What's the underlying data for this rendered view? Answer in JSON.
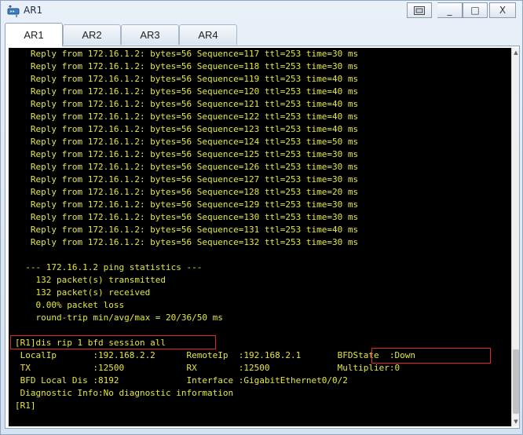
{
  "window": {
    "title": "AR1",
    "tabs": [
      "AR1",
      "AR2",
      "AR3",
      "AR4"
    ],
    "active_tab": "AR1"
  },
  "controls": {
    "restore": "▭",
    "minimize": "_",
    "maximize": "□",
    "close": "X"
  },
  "terminal": {
    "lines": [
      "   Reply from 172.16.1.2: bytes=56 Sequence=117 ttl=253 time=30 ms",
      "   Reply from 172.16.1.2: bytes=56 Sequence=118 ttl=253 time=30 ms",
      "   Reply from 172.16.1.2: bytes=56 Sequence=119 ttl=253 time=40 ms",
      "   Reply from 172.16.1.2: bytes=56 Sequence=120 ttl=253 time=40 ms",
      "   Reply from 172.16.1.2: bytes=56 Sequence=121 ttl=253 time=40 ms",
      "   Reply from 172.16.1.2: bytes=56 Sequence=122 ttl=253 time=40 ms",
      "   Reply from 172.16.1.2: bytes=56 Sequence=123 ttl=253 time=40 ms",
      "   Reply from 172.16.1.2: bytes=56 Sequence=124 ttl=253 time=50 ms",
      "   Reply from 172.16.1.2: bytes=56 Sequence=125 ttl=253 time=30 ms",
      "   Reply from 172.16.1.2: bytes=56 Sequence=126 ttl=253 time=30 ms",
      "   Reply from 172.16.1.2: bytes=56 Sequence=127 ttl=253 time=30 ms",
      "   Reply from 172.16.1.2: bytes=56 Sequence=128 ttl=253 time=20 ms",
      "   Reply from 172.16.1.2: bytes=56 Sequence=129 ttl=253 time=30 ms",
      "   Reply from 172.16.1.2: bytes=56 Sequence=130 ttl=253 time=30 ms",
      "   Reply from 172.16.1.2: bytes=56 Sequence=131 ttl=253 time=40 ms",
      "   Reply from 172.16.1.2: bytes=56 Sequence=132 ttl=253 time=30 ms",
      "",
      "  --- 172.16.1.2 ping statistics ---",
      "    132 packet(s) transmitted",
      "    132 packet(s) received",
      "    0.00% packet loss",
      "    round-trip min/avg/max = 20/36/50 ms",
      "",
      "[R1]dis rip 1 bfd session all",
      " LocalIp       :192.168.2.2      RemoteIp  :192.168.2.1       BFDState  :Down",
      " TX            :12500            RX        :12500             Multiplier:0",
      " BFD Local Dis :8192             Interface :GigabitEthernet0/0/2",
      " Diagnostic Info:No diagnostic information",
      "[R1]"
    ]
  },
  "colors": {
    "terminal_bg": "#000000",
    "terminal_text": "#e6e63c",
    "highlight": "#e02828"
  }
}
